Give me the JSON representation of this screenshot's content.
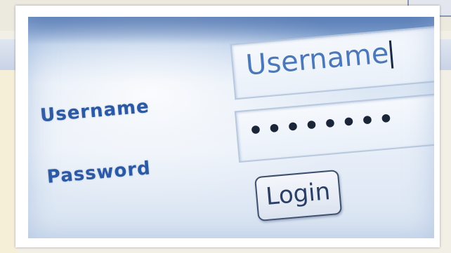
{
  "form": {
    "username_label": "Username",
    "password_label": "Password",
    "username_value": "Username",
    "password_value": "••••••••",
    "login_label": "Login"
  },
  "colors": {
    "label_blue": "#2c59a3",
    "field_text_blue": "#4a78b9",
    "frame_white": "#ffffff"
  }
}
